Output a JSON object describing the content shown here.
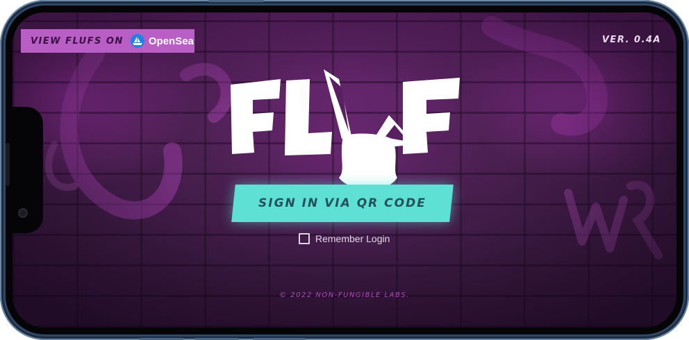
{
  "badge": {
    "prefix": "VIEW FLUFS ON",
    "brand": "OpenSea",
    "brand_color": "#2081e2"
  },
  "version": "VER. 0.4A",
  "logo": {
    "text": "FLUF",
    "icon": "bunny-head-icon"
  },
  "signin": {
    "label": "SIGN IN VIA QR CODE",
    "color": "#5ee0d4"
  },
  "remember": {
    "label": "Remember Login",
    "checked": false
  },
  "footer": "© 2022 NON-FUNGIBLE LABS.",
  "colors": {
    "background": "#4a2050",
    "accent_magenta": "#b85ec4",
    "frame": "#2f4763"
  }
}
